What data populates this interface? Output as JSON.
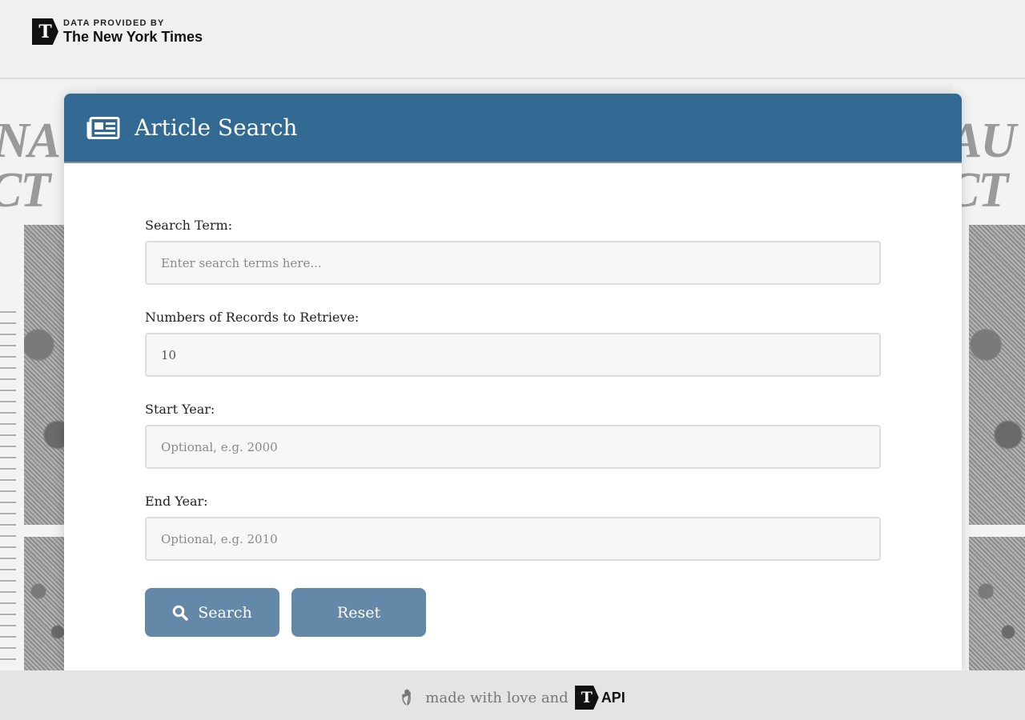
{
  "header": {
    "attribution_small": "DATA PROVIDED BY",
    "attribution_big": "The New York Times",
    "logo_glyph": "T"
  },
  "card": {
    "title": "Article Search",
    "icon": "newspaper-icon"
  },
  "form": {
    "search_term": {
      "label": "Search Term:",
      "value": "",
      "placeholder": "Enter search terms here..."
    },
    "records": {
      "label": "Numbers of Records to Retrieve:",
      "value": "10",
      "placeholder": ""
    },
    "start_year": {
      "label": "Start Year:",
      "value": "",
      "placeholder": "Optional, e.g. 2000"
    },
    "end_year": {
      "label": "End Year:",
      "value": "",
      "placeholder": "Optional, e.g. 2010"
    }
  },
  "buttons": {
    "search_label": "Search",
    "reset_label": "Reset"
  },
  "footer": {
    "text": "made with love and",
    "logo_glyph": "T",
    "api_label": "API"
  },
  "colors": {
    "header_bar": "#336a94",
    "button": "#6489a8",
    "page_bg": "#f0f0f0"
  }
}
